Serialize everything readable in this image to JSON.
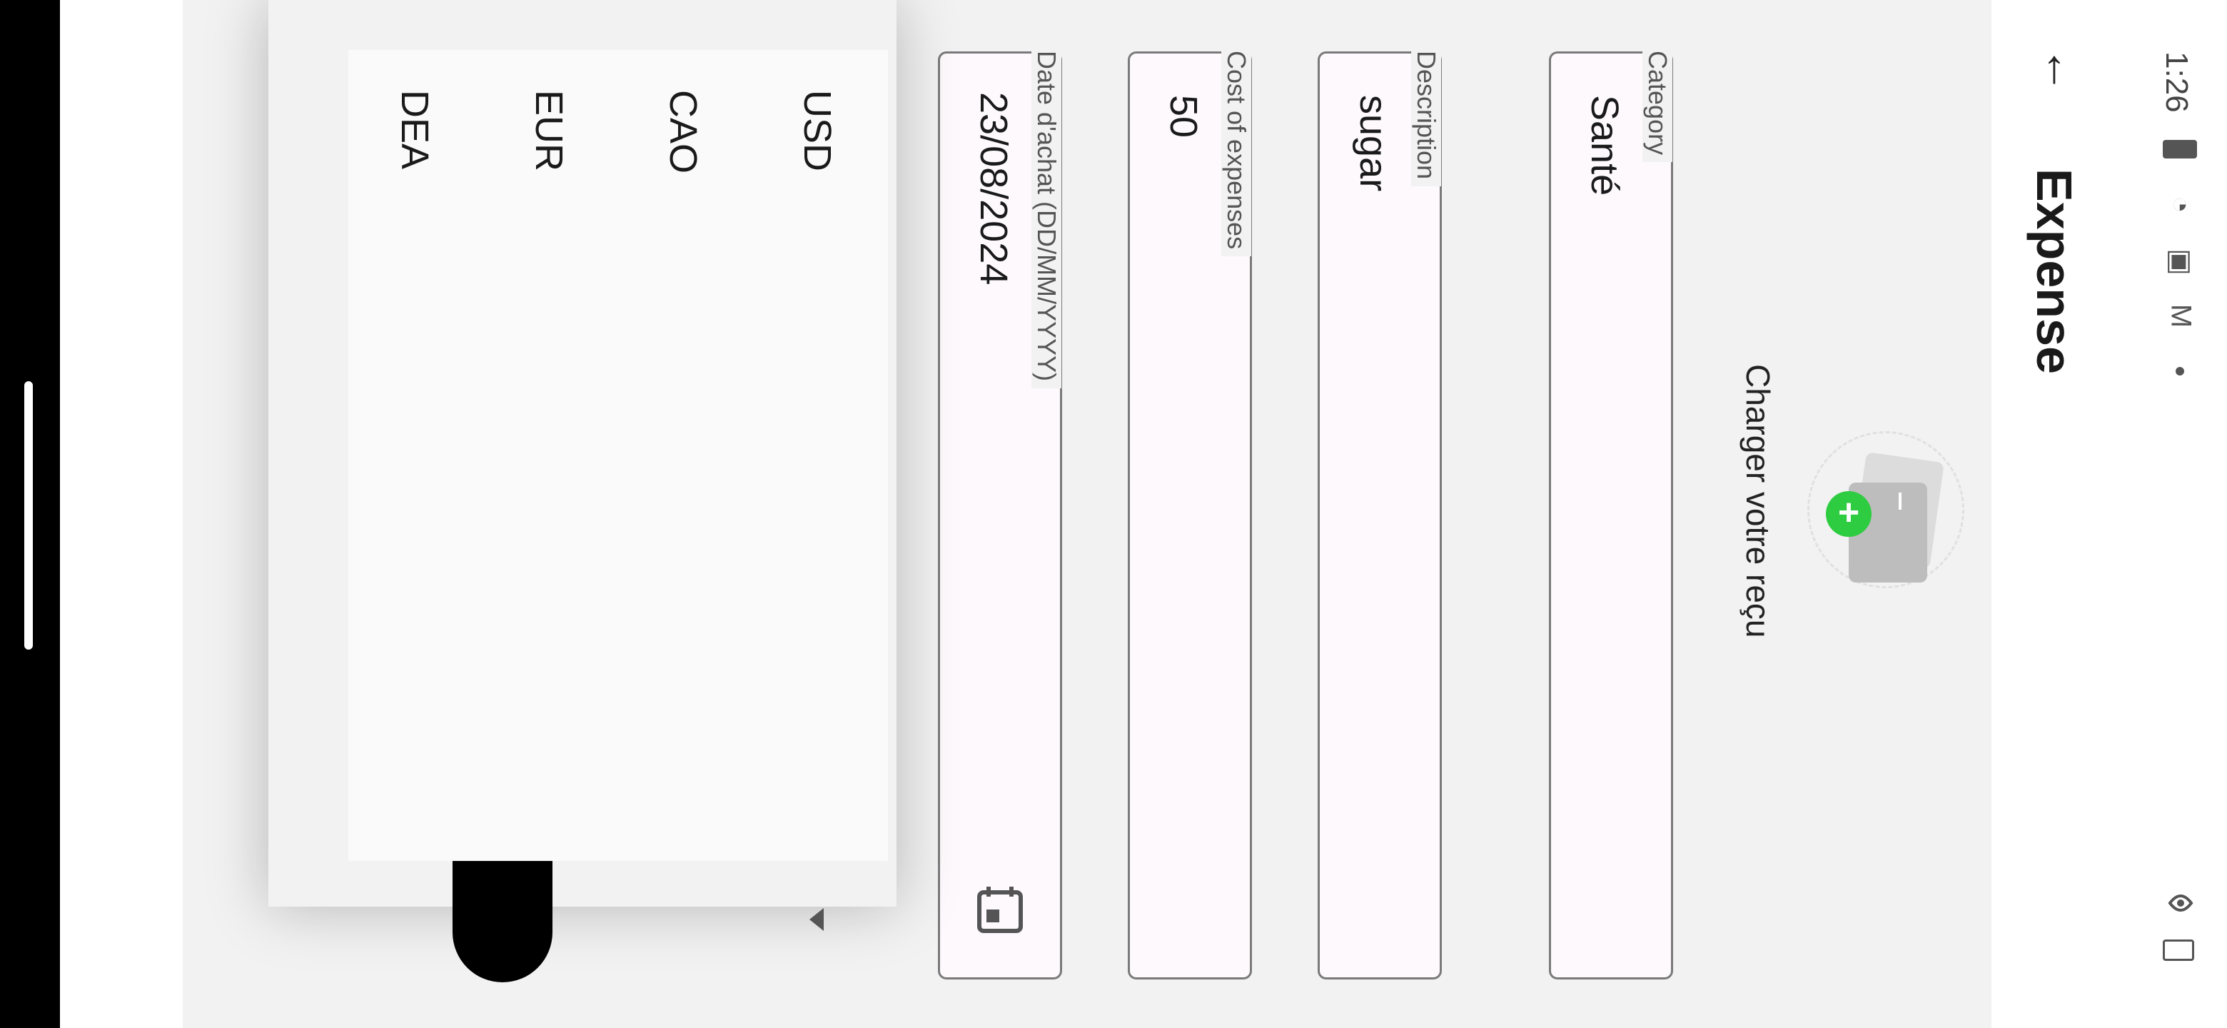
{
  "status_bar": {
    "time": "1:26"
  },
  "app_bar": {
    "title": "Expense",
    "back_icon": "arrow-back-icon"
  },
  "upload": {
    "label": "Charger votre reçu",
    "icon": "receipt-add-icon"
  },
  "form": {
    "category": {
      "label": "Category",
      "value": "Santé"
    },
    "description": {
      "label": "Description",
      "value": "sugar"
    },
    "cost": {
      "label": "Cost of expenses",
      "value": "50"
    },
    "date": {
      "label": "Date d'achat (DD/MM/YYYY)",
      "value": "23/08/2024",
      "icon": "calendar-icon"
    }
  },
  "currency_dropdown": {
    "options": [
      "USD",
      "CAO",
      "EUR",
      "DEA"
    ]
  },
  "colors": {
    "accent_green": "#2ecc40",
    "field_border": "#7a7a7a",
    "background": "#f2f2f2"
  }
}
